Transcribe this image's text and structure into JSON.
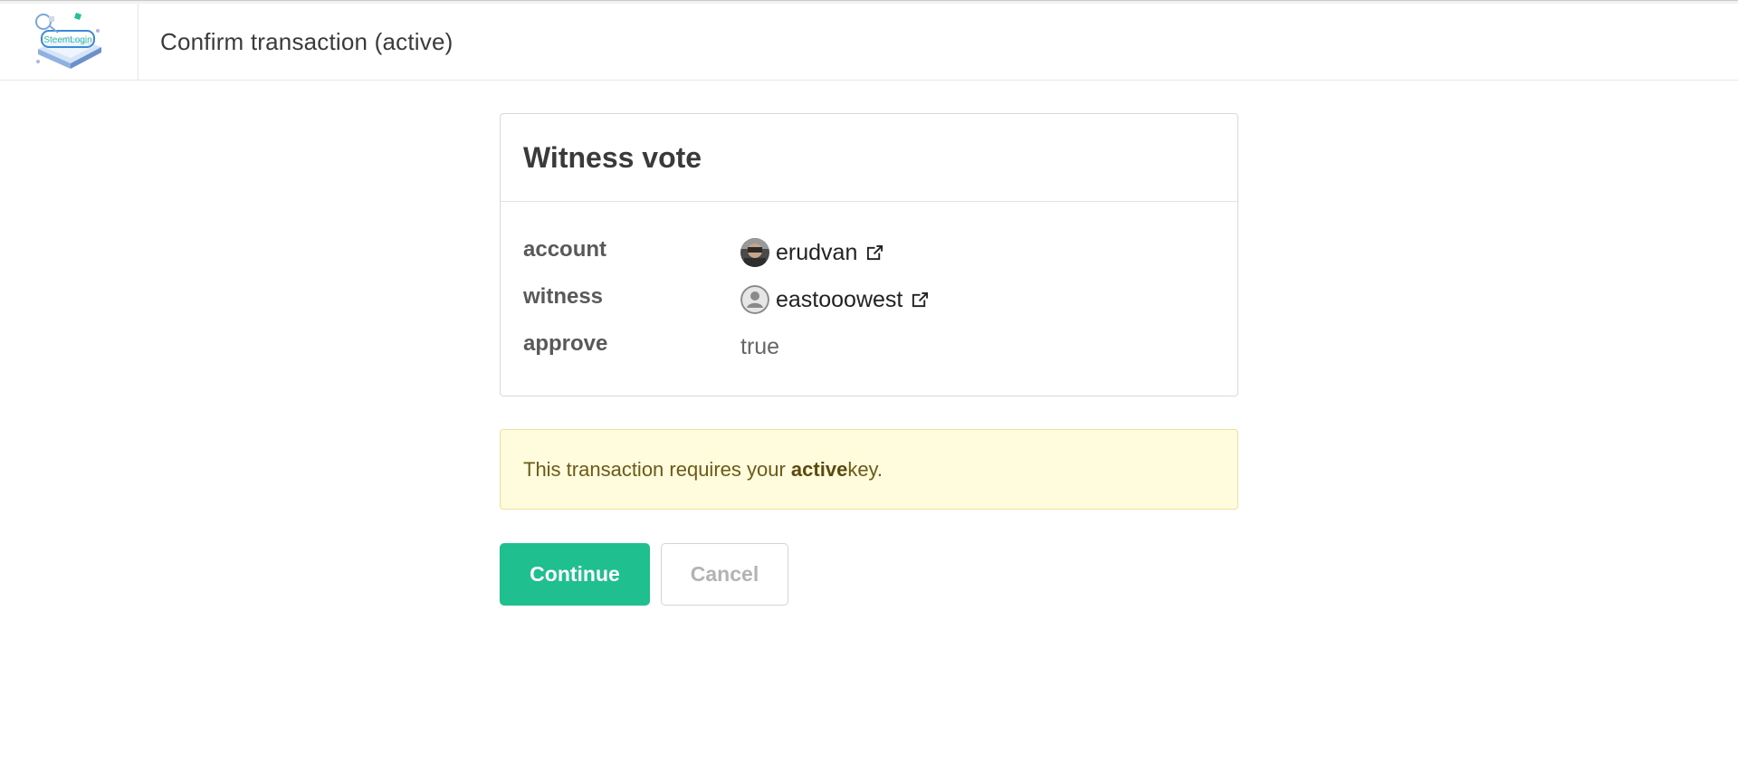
{
  "header": {
    "logo_icon": "steemlogin-logo-icon",
    "title": "Confirm transaction (active)"
  },
  "card": {
    "title": "Witness vote",
    "rows": [
      {
        "key": "account",
        "value": "erudvan",
        "avatar": "user-photo-avatar",
        "link_icon": "external-link-icon"
      },
      {
        "key": "witness",
        "value": "eastooowest",
        "avatar": "default-user-avatar",
        "link_icon": "external-link-icon"
      },
      {
        "key": "approve",
        "value": "true"
      }
    ]
  },
  "notice": {
    "prefix": "This transaction requires your ",
    "emphasis": "active",
    "suffix": " key."
  },
  "actions": {
    "continue_label": "Continue",
    "cancel_label": "Cancel"
  },
  "colors": {
    "primary": "#1fbf8f",
    "notice_bg": "#fffbdc",
    "notice_border": "#ebe1a3"
  }
}
